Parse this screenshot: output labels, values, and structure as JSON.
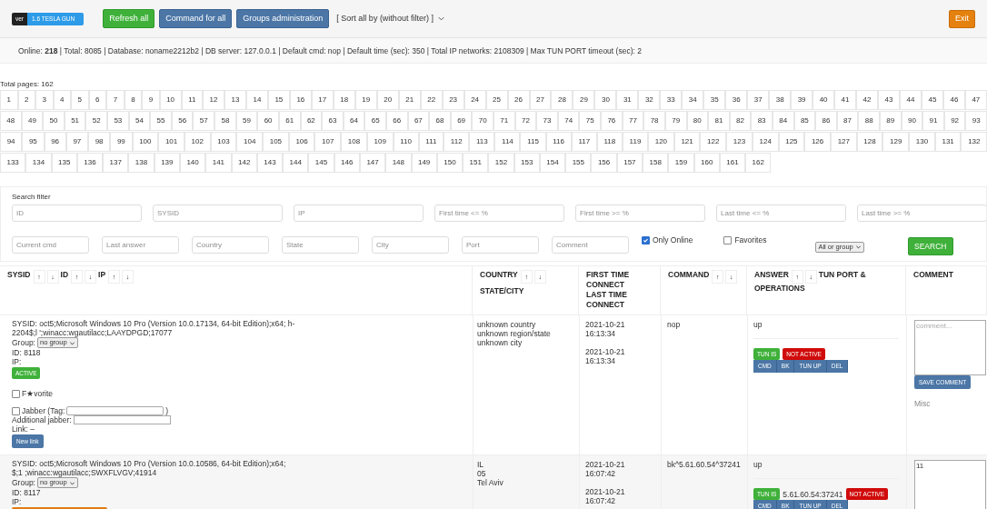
{
  "header": {
    "version_label": "ver",
    "version": "1.6 TESLA GUN",
    "buttons": [
      {
        "label": "Refresh all",
        "kind": "success"
      },
      {
        "label": "Command for all",
        "kind": "primary"
      },
      {
        "label": "Groups administration",
        "kind": "primary"
      }
    ],
    "sort": "[ Sort all by (without filter) ]",
    "exit": "Exit"
  },
  "info": "Online: **218** | Total: 8085 | Database: noname2212b2 | DB server: 127.0.0.1 | Default cmd: nop | Default time (sec): 350 | Total IP networks: 2108309 | Max TUN PORT timeout (sec): 2",
  "pagination": {
    "title": "Total pages: 162",
    "pages": [
      "1",
      "2",
      "3",
      "4",
      "5",
      "6",
      "7",
      "8",
      "9",
      "10",
      "11",
      "12",
      "13",
      "14",
      "15",
      "16",
      "17",
      "18",
      "19",
      "20",
      "21",
      "22",
      "23",
      "24",
      "25",
      "26",
      "27",
      "28",
      "29",
      "30",
      "31",
      "32",
      "33",
      "34",
      "35",
      "36",
      "37",
      "38",
      "39",
      "40",
      "41",
      "42",
      "43",
      "44",
      "45",
      "46",
      "47",
      "48",
      "49",
      "50",
      "51",
      "52",
      "53",
      "54",
      "55",
      "56",
      "57",
      "58",
      "59",
      "60",
      "61",
      "62",
      "63",
      "64",
      "65",
      "66",
      "67",
      "68",
      "69",
      "70",
      "71",
      "72",
      "73",
      "74",
      "75",
      "76",
      "77",
      "78",
      "79",
      "80",
      "81",
      "82",
      "83",
      "84",
      "85",
      "86",
      "87",
      "88",
      "89",
      "90",
      "91",
      "92",
      "93",
      "94",
      "95",
      "96",
      "97",
      "98",
      "99",
      "100",
      "101",
      "102",
      "103",
      "104",
      "105",
      "106",
      "107",
      "108",
      "109",
      "110",
      "111",
      "112",
      "113",
      "114",
      "115",
      "116",
      "117",
      "118",
      "119",
      "120",
      "121",
      "122",
      "123",
      "124",
      "125",
      "126",
      "127",
      "128",
      "129",
      "130",
      "131",
      "132",
      "133",
      "134",
      "135",
      "136",
      "137",
      "138",
      "139",
      "140",
      "141",
      "142",
      "143",
      "144",
      "145",
      "146",
      "147",
      "148",
      "149",
      "150",
      "151",
      "152",
      "153",
      "154",
      "155",
      "156",
      "157",
      "158",
      "159",
      "160",
      "161",
      "162"
    ]
  },
  "filter": {
    "title": "Search filter",
    "fields_row1": [
      {
        "placeholder": "ID"
      },
      {
        "placeholder": "SYSID"
      },
      {
        "placeholder": "IP"
      },
      {
        "placeholder": "First time <= %"
      },
      {
        "placeholder": "First time >= %"
      },
      {
        "placeholder": "Last time <= %"
      },
      {
        "placeholder": "Last time >= %"
      }
    ],
    "fields_row2": [
      {
        "placeholder": "Current cmd"
      },
      {
        "placeholder": "Last answer"
      },
      {
        "placeholder": "Country"
      },
      {
        "placeholder": "State"
      },
      {
        "placeholder": "City"
      },
      {
        "placeholder": "Port"
      },
      {
        "placeholder": "Comment"
      }
    ],
    "only_online": {
      "label": "Only Online",
      "checked": true
    },
    "favorites": {
      "label": "Favorites",
      "checked": false
    },
    "group_select": "All or group",
    "search": "SEARCH"
  },
  "table": {
    "columns": [
      {
        "lines": [
          [
            {
              "label": "SYSID",
              "sort": [
                "↑",
                "↓"
              ]
            },
            {
              "label": "ID",
              "sort": [
                "↑",
                "↓"
              ]
            },
            {
              "label": "IP",
              "sort": [
                "↑",
                "↓"
              ]
            }
          ]
        ]
      },
      {
        "lines": [
          [
            {
              "label": "COUNTRY",
              "sort": [
                "↑",
                "↓"
              ]
            }
          ],
          [
            {
              "label": "STATE/CITY"
            }
          ]
        ]
      },
      {
        "lines": [
          [
            {
              "label": "FIRST TIME CONNECT"
            }
          ],
          [
            {
              "label": "LAST TIME CONNECT"
            }
          ]
        ]
      },
      {
        "lines": [
          [
            {
              "label": "COMMAND",
              "sort": [
                "↑",
                "↓"
              ]
            }
          ]
        ]
      },
      {
        "lines": [
          [
            {
              "label": "ANSWER",
              "sort": [
                "↑",
                "↓"
              ]
            },
            {
              "label": "TUN PORT &"
            }
          ],
          [
            {
              "label": "OPERATIONS"
            }
          ]
        ]
      },
      {
        "lines": [
          [
            {
              "label": "COMMENT"
            }
          ]
        ]
      }
    ],
    "rows": [
      {
        "sysid": "SYSID: oct5;Microsoft Windows 10 Pro (Version 10.0.17134, 64-bit Edition);x64; h-2204$;l ';winacc:wgautilacc;LAAYDPGD;17077",
        "group_label": "Group:",
        "group": "no group",
        "id": "ID: 8118",
        "ip": "IP:",
        "status": {
          "label": "ACTIVE",
          "kind": "active"
        },
        "favorite": {
          "label": "F★vorite",
          "checked": false
        },
        "jabber": {
          "label": "Jabber (Tag:",
          "close": ")",
          "checked": false
        },
        "additional_jabber": "Additional jabber:",
        "link": "Link: –",
        "new_link": "New link",
        "location": [
          "unknown country",
          "unknown region/state",
          "unknown city"
        ],
        "times": [
          "2021-10-21 16:13:34",
          "2021-10-21 16:13:34"
        ],
        "command": "nop",
        "answer": "up",
        "tun": {
          "label": "TUN IS",
          "state": "NOT ACTIVE"
        },
        "ops": [
          "CMD",
          "BK",
          "TUN UP",
          "DEL"
        ],
        "comment": {
          "placeholder": "comment...",
          "save": "SAVE COMMENT",
          "misc": "Misc"
        }
      },
      {
        "sysid": "SYSID: oct5;Microsoft Windows 10 Pro (Version 10.0.10586, 64-bit Edition);x64; $;1 ;winacc:wgautilacc;SWXFLVGV;41914",
        "group_label": "Group:",
        "group": "no group",
        "id": "ID: 8117",
        "ip": "IP:",
        "status": {
          "kind": "no_connections"
        },
        "location": [
          "IL",
          "05",
          "Tel Aviv"
        ],
        "times": [
          "2021-10-21 16:07:42",
          "2021-10-21 16:07:42"
        ],
        "command": "bk^5.61.60.54^37241",
        "answer": "up",
        "tun": {
          "label": "TUN IS",
          "port": "5.61.60.54:37241",
          "state": "NOT ACTIVE"
        },
        "ops": [
          "CMD",
          "BK",
          "TUN UP",
          "DEL"
        ],
        "comment": {
          "value": "11"
        }
      }
    ]
  }
}
